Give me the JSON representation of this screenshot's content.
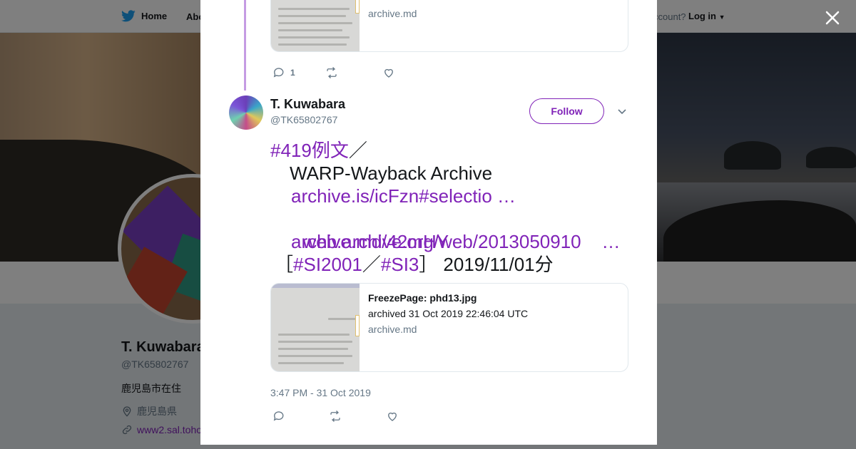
{
  "nav": {
    "home_label": "Home",
    "about_label": "Abo",
    "account_prompt": "ccount?",
    "login_label": "Log in"
  },
  "profile": {
    "name": "T. Kuwabara",
    "handle": "@TK65802767",
    "bio": "鹿児島市在住",
    "location": "鹿児島県",
    "url": "www2.sal.toho"
  },
  "prev_card": {
    "domain": "archive.md"
  },
  "prev_actions": {
    "reply_count": "1"
  },
  "tweet": {
    "author_name": "T. Kuwabara",
    "author_handle": "@TK65802767",
    "follow_label": "Follow",
    "lines": {
      "l1_tag": "#419例文",
      "l1_sep": "／",
      "l2": "WARP-Wayback Archive",
      "l3_link": "archive.is/icFzn#selectio …",
      "l4_link": "web.archive.org/web/2013050910    …",
      "l5_link": "archive.md/42mHY",
      "l6_open": "［",
      "l6_tag1": "#SI2001",
      "l6_sep": "／",
      "l6_tag2": "#SI3",
      "l6_close": "］",
      "l6_date": "2019/11/01分"
    },
    "timestamp": "3:47 PM - 31 Oct 2019"
  },
  "card": {
    "title": "FreezePage: phd13.jpg",
    "description": "archived 31 Oct 2019 22:46:04 UTC",
    "domain": "archive.md"
  },
  "colors": {
    "accent": "#8023b8",
    "thread": "#c59be3",
    "muted": "#657786",
    "brand_bird": "#1da1f2"
  },
  "icons": [
    "twitter-bird-icon",
    "close-icon",
    "reply-icon",
    "retweet-icon",
    "like-icon",
    "chevron-down-icon",
    "location-icon",
    "link-icon"
  ]
}
